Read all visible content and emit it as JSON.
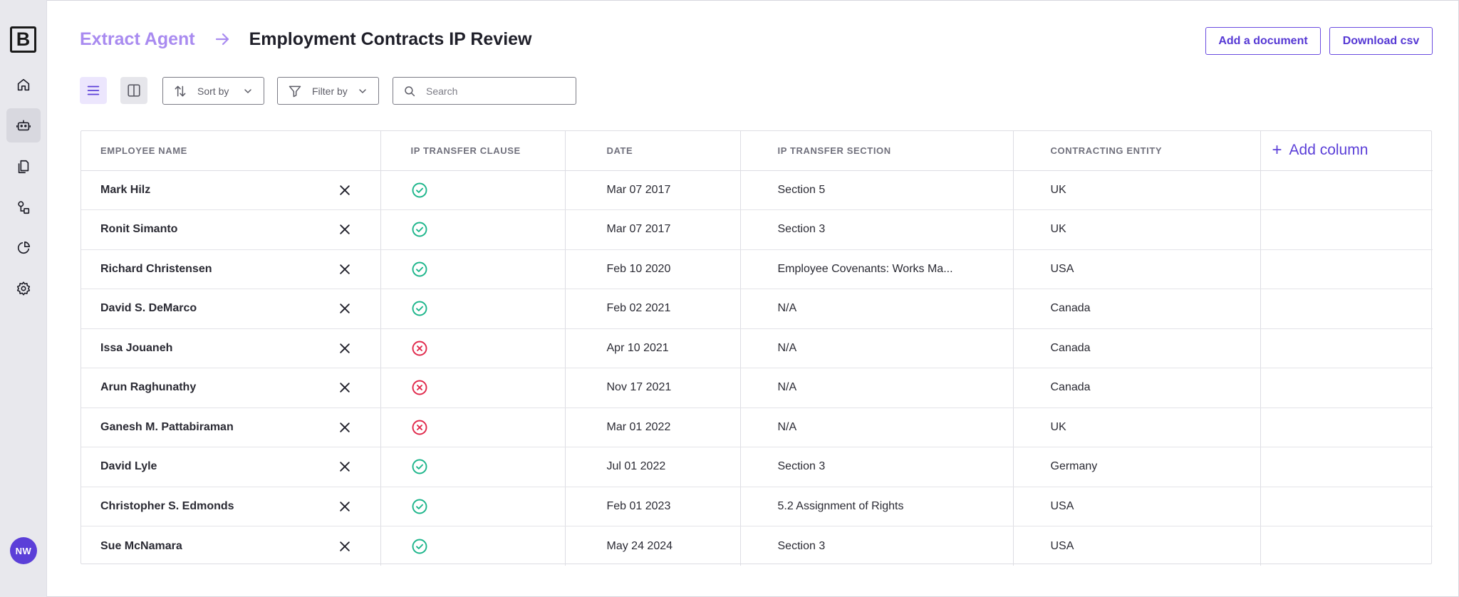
{
  "sidebar": {
    "logo_text": "B",
    "items": [
      {
        "name": "home",
        "icon": "home-icon",
        "active": false
      },
      {
        "name": "agents",
        "icon": "robot-icon",
        "active": true
      },
      {
        "name": "documents",
        "icon": "documents-icon",
        "active": false
      },
      {
        "name": "workflows",
        "icon": "workflow-icon",
        "active": false
      },
      {
        "name": "analytics",
        "icon": "pie-chart-icon",
        "active": false
      },
      {
        "name": "settings",
        "icon": "gear-icon",
        "active": false
      }
    ],
    "avatar_initials": "NW"
  },
  "header": {
    "breadcrumb_parent": "Extract Agent",
    "title": "Employment Contracts IP Review",
    "add_document_label": "Add a document",
    "download_csv_label": "Download csv"
  },
  "toolbar": {
    "sort_label": "Sort by",
    "filter_label": "Filter by",
    "search_placeholder": "Search"
  },
  "table": {
    "columns": [
      "EMPLOYEE NAME",
      "IP TRANSFER CLAUSE",
      "DATE",
      "IP TRANSFER SECTION",
      "CONTRACTING ENTITY"
    ],
    "add_column_label": "Add column",
    "rows": [
      {
        "name": "Mark Hilz",
        "clause": "yes",
        "date": "Mar 07 2017",
        "section": "Section 5",
        "entity": "UK"
      },
      {
        "name": "Ronit Simanto",
        "clause": "yes",
        "date": "Mar 07 2017",
        "section": "Section 3",
        "entity": "UK"
      },
      {
        "name": "Richard Christensen",
        "clause": "yes",
        "date": "Feb 10 2020",
        "section": "Employee Covenants: Works Ma...",
        "entity": "USA"
      },
      {
        "name": "David S. DeMarco",
        "clause": "yes",
        "date": "Feb 02 2021",
        "section": "N/A",
        "entity": "Canada"
      },
      {
        "name": "Issa Jouaneh",
        "clause": "no",
        "date": "Apr 10 2021",
        "section": "N/A",
        "entity": "Canada"
      },
      {
        "name": "Arun Raghunathy",
        "clause": "no",
        "date": "Nov 17 2021",
        "section": "N/A",
        "entity": "Canada"
      },
      {
        "name": "Ganesh M. Pattabiraman",
        "clause": "no",
        "date": "Mar 01 2022",
        "section": "N/A",
        "entity": "UK"
      },
      {
        "name": "David Lyle",
        "clause": "yes",
        "date": "Jul 01 2022",
        "section": "Section 3",
        "entity": "Germany"
      },
      {
        "name": "Christopher S. Edmonds",
        "clause": "yes",
        "date": "Feb 01 2023",
        "section": "5.2 Assignment of Rights",
        "entity": "USA"
      },
      {
        "name": "Sue McNamara",
        "clause": "yes",
        "date": "May 24 2024",
        "section": "Section 3",
        "entity": "USA"
      }
    ]
  },
  "colors": {
    "accent": "#5b3fd8",
    "breadcrumb_parent": "#a98bf0",
    "check_green": "#1bb58a",
    "cross_red": "#e0284a"
  }
}
